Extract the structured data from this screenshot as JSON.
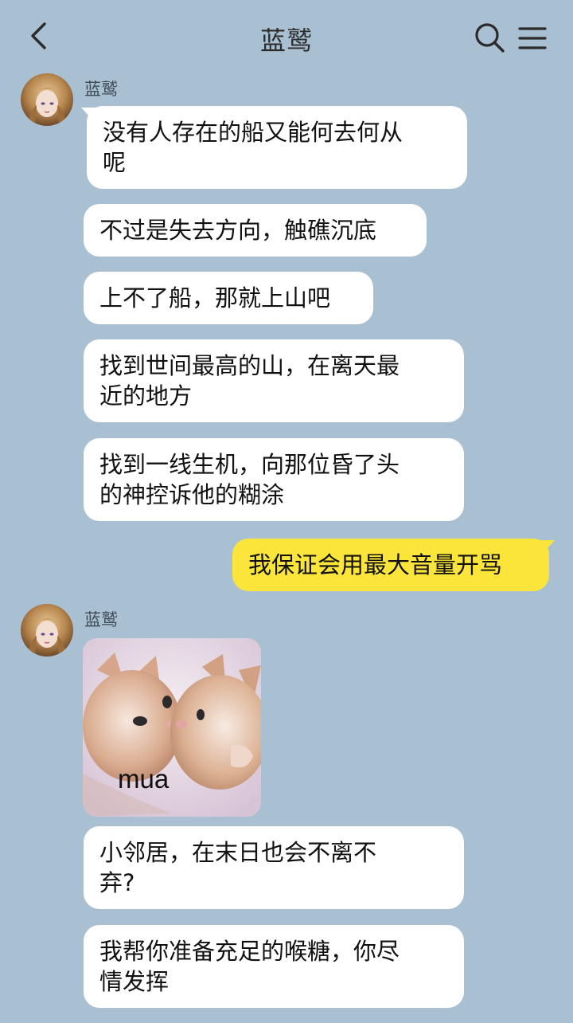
{
  "header": {
    "title": "蓝鹫",
    "back_icon": "chevron-left-icon",
    "search_icon": "search-icon",
    "menu_icon": "menu-icon"
  },
  "colors": {
    "background": "#a9bfd2",
    "incoming_bubble": "#ffffff",
    "outgoing_bubble": "#fbe53a"
  },
  "messages": [
    {
      "sender": "蓝鹫",
      "text_lines": [
        "没有人存在的船又能何去何从",
        "呢"
      ]
    },
    {
      "text_lines": [
        "不过是失去方向，触礁沉底"
      ]
    },
    {
      "text_lines": [
        "上不了船，那就上山吧"
      ]
    },
    {
      "text_lines": [
        "找到世间最高的山，在离天最",
        "近的地方"
      ]
    },
    {
      "text_lines": [
        "找到一线生机，向那位昏了头",
        "的神控诉他的糊涂"
      ]
    },
    {
      "text_lines": [
        "我保证会用最大音量开骂"
      ]
    },
    {
      "sender": "蓝鹫",
      "sticker_caption": "mua"
    },
    {
      "text_lines": [
        "小邻居，在末日也会不离不",
        "弃?"
      ]
    },
    {
      "text_lines": [
        "我帮你准备充足的喉糖，你尽",
        "情发挥"
      ]
    }
  ]
}
